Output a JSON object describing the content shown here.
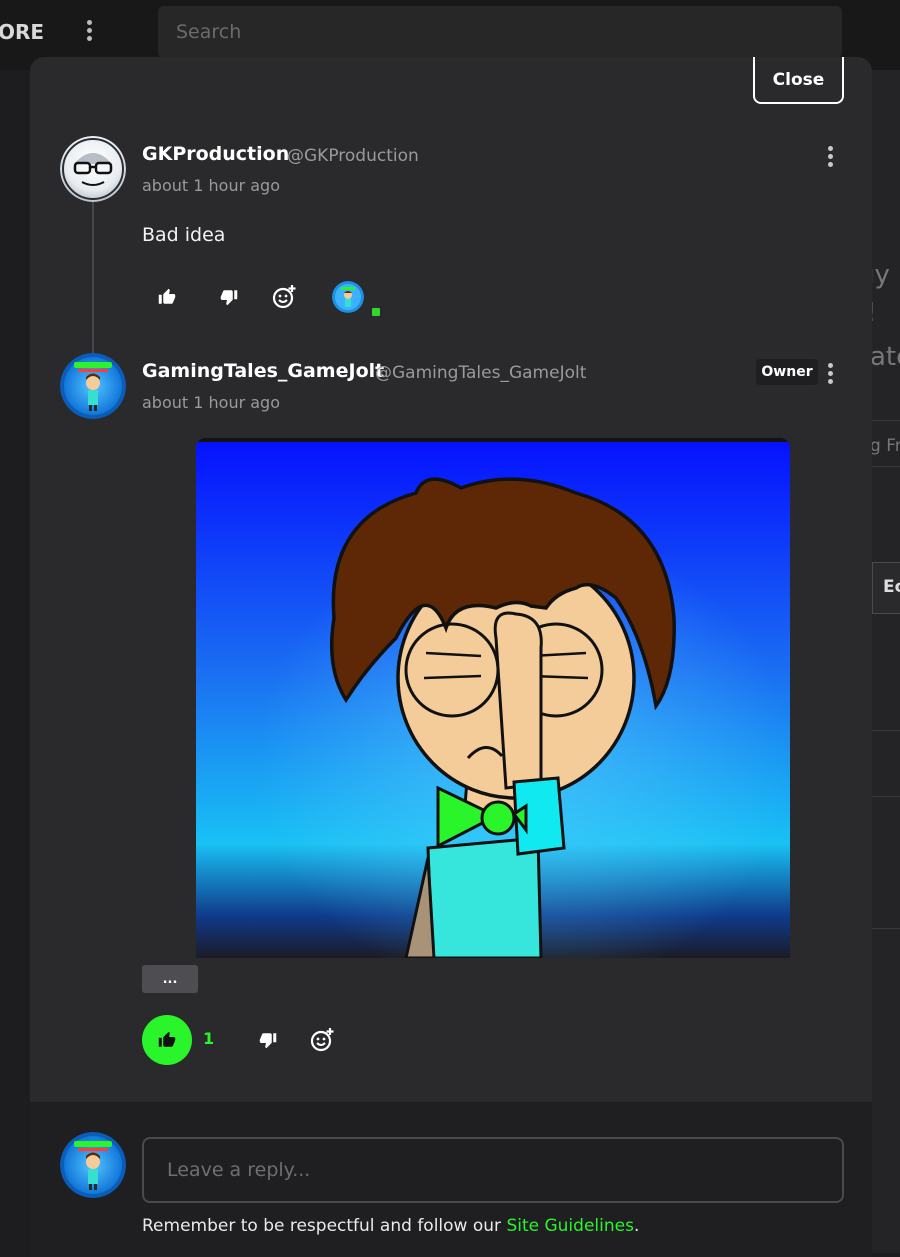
{
  "topbar": {
    "brand_fragment": "ORE",
    "search_placeholder": "Search"
  },
  "background_fragments": [
    "gy",
    "!",
    "ate",
    "g Fr",
    "Ec"
  ],
  "modal": {
    "close_label": "Close",
    "comments": [
      {
        "username": "GKProduction",
        "handle": "@GKProduction",
        "time": "about 1 hour ago",
        "text": "Bad idea"
      },
      {
        "username": "GamingTales_GameJolt",
        "handle": "@GamingTales_GameJolt",
        "time": "about 1 hour ago",
        "badge": "Owner",
        "expand_label": "...",
        "like_count": "1"
      }
    ],
    "reply": {
      "placeholder": "Leave a reply...",
      "guidelines_prefix": "Remember to be respectful and follow our ",
      "guidelines_link": "Site Guidelines",
      "guidelines_suffix": "."
    }
  },
  "icons": [
    "thumbs-up-icon",
    "thumbs-down-icon",
    "add-reaction-icon",
    "more-options-icon"
  ],
  "colors": {
    "accent_green": "#2af52a",
    "modal_bg": "#2a292c",
    "page_bg": "#1d1c1e"
  }
}
